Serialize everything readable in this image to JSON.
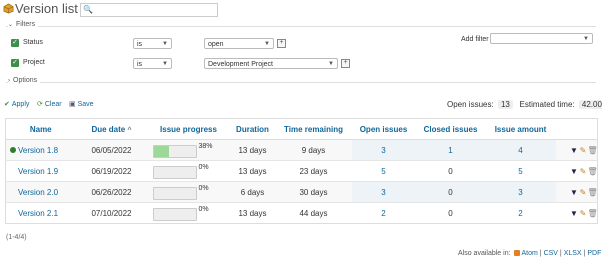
{
  "page": {
    "title": "Version list",
    "search_placeholder": ""
  },
  "filters": {
    "legend": "Filters",
    "rows": [
      {
        "label": "Status",
        "operator": "is",
        "value": "open"
      },
      {
        "label": "Project",
        "operator": "is",
        "value": "Development Project"
      }
    ],
    "add_filter_label": "Add filter",
    "add_filter_value": ""
  },
  "options": {
    "legend": "Options"
  },
  "actions": {
    "apply": "Apply",
    "clear": "Clear",
    "save": "Save"
  },
  "summary": {
    "open_issues_label": "Open issues:",
    "open_issues_value": "13",
    "estimated_time_label": "Estimated time:",
    "estimated_time_value": "42.00"
  },
  "table": {
    "columns": [
      "Name",
      "Due date",
      "Issue progress",
      "Duration",
      "Time remaining",
      "Open issues",
      "Closed issues",
      "Issue amount"
    ],
    "sort_indicator": "^",
    "rows": [
      {
        "name": "Version 1.8",
        "due": "06/05/2022",
        "progress": 38,
        "progress_label": "38%",
        "duration": "13 days",
        "remaining": "9 days",
        "open": "3",
        "closed": "1",
        "amount": "4",
        "status_dot": true
      },
      {
        "name": "Version 1.9",
        "due": "06/19/2022",
        "progress": 0,
        "progress_label": "0%",
        "duration": "13 days",
        "remaining": "23 days",
        "open": "5",
        "closed": "0",
        "amount": "5",
        "status_dot": false
      },
      {
        "name": "Version 2.0",
        "due": "06/26/2022",
        "progress": 0,
        "progress_label": "0%",
        "duration": "6 days",
        "remaining": "30 days",
        "open": "3",
        "closed": "0",
        "amount": "3",
        "status_dot": false
      },
      {
        "name": "Version 2.1",
        "due": "07/10/2022",
        "progress": 0,
        "progress_label": "0%",
        "duration": "13 days",
        "remaining": "44 days",
        "open": "2",
        "closed": "0",
        "amount": "2",
        "status_dot": false
      }
    ]
  },
  "pagination": "(1-4/4)",
  "footer": {
    "available_in": "Also available in:",
    "formats": [
      "Atom",
      "CSV",
      "XLSX",
      "PDF"
    ],
    "separator": "|"
  },
  "colors": {
    "link": "#116699",
    "checkbox": "#3d8e4b",
    "progress_fill": "#9ed898",
    "status_dot": "#2e7d32",
    "highlight_cell": "#eef3f8"
  },
  "icons": {
    "page": "package-icon",
    "search": "search-icon",
    "apply": "check-icon",
    "clear": "reload-icon",
    "save": "save-icon",
    "row_filter": "filter-icon",
    "row_edit": "pencil-icon",
    "row_delete": "trash-icon",
    "feed": "feed-icon"
  }
}
